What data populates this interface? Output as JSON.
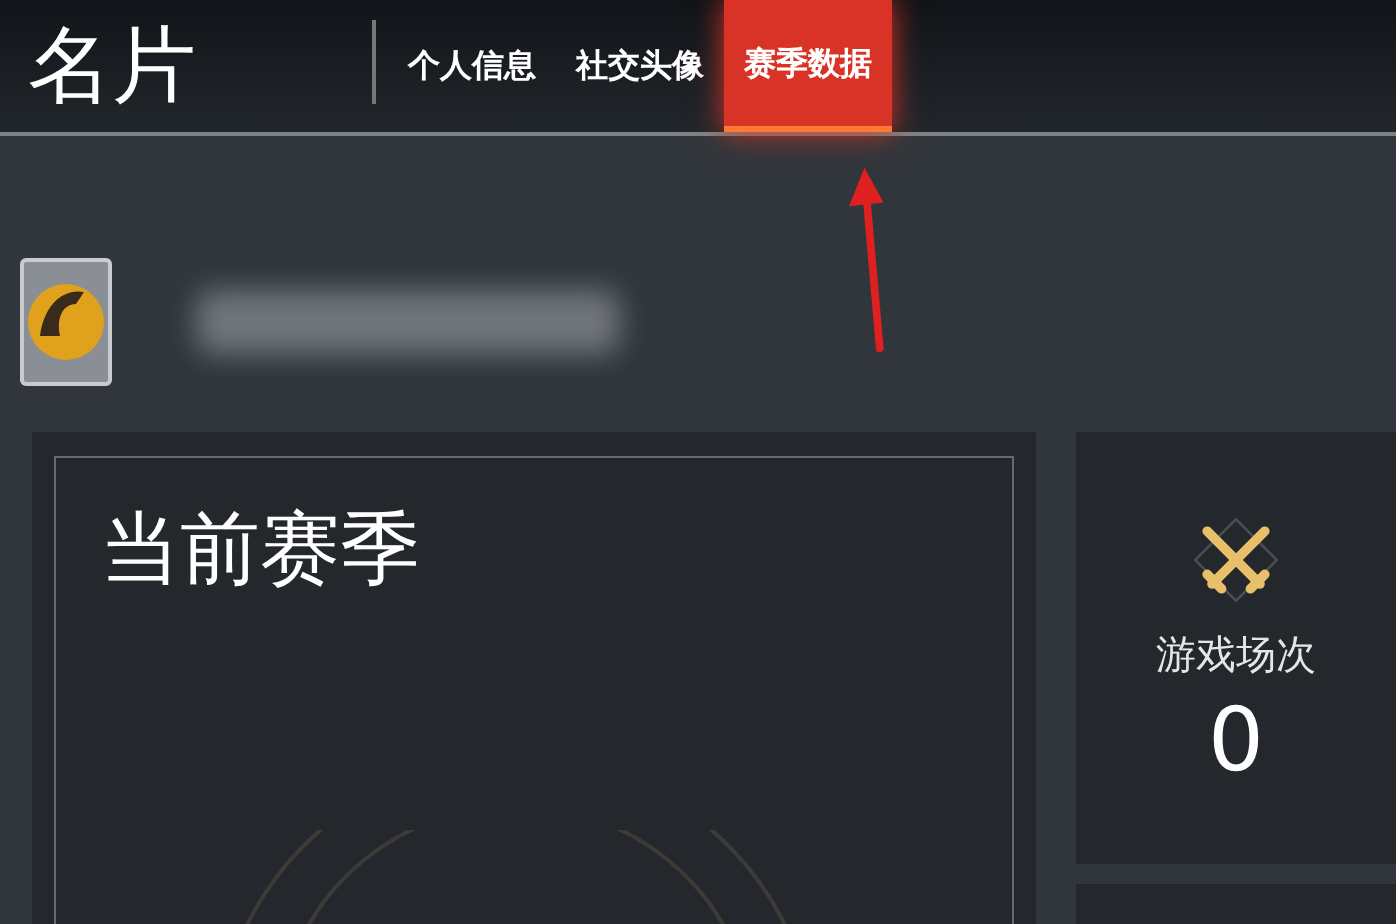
{
  "header": {
    "title": "名片"
  },
  "tabs": [
    {
      "label": "个人信息",
      "selected": false
    },
    {
      "label": "社交头像",
      "selected": false
    },
    {
      "label": "赛季数据",
      "selected": true
    }
  ],
  "season_panel": {
    "title": "当前赛季"
  },
  "stats": [
    {
      "label": "游戏场次",
      "value": "0"
    }
  ]
}
